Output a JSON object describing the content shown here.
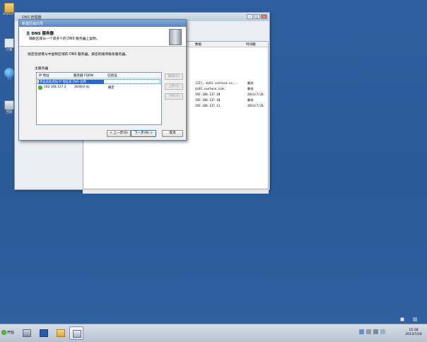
{
  "desktop": {
    "icons": [
      {
        "label": "Adminis",
        "icon": "folder-icon"
      },
      {
        "label": "计算",
        "icon": "computer-icon"
      },
      {
        "label": "Fl",
        "icon": "internet-explorer-icon"
      },
      {
        "label": "回收",
        "icon": "recycle-bin-icon"
      }
    ]
  },
  "dns_manager": {
    "title": "DNS 管理器",
    "columns": [
      "数据",
      "时间戳"
    ],
    "rows": [
      {
        "data": "[22], dc01.contoso.co...",
        "time": "静态"
      },
      {
        "data": "dc01.contoso.com.",
        "time": "静态"
      },
      {
        "data": "192.168.137.10",
        "time": "2013/7/26"
      },
      {
        "data": "192.168.137.10",
        "time": "静态"
      },
      {
        "data": "192.168.137.11",
        "time": "2013/7/26"
      }
    ]
  },
  "wizard": {
    "title": "新建区域向导",
    "header_title": "主 DNS 服务器",
    "header_subtitle": "辅助区域从一个或多个的 DNS 服务器上复制。",
    "description": "指定您想要从中复制区域的 DNS 服务器。按您的顺序联系服务器。",
    "group_label": "主服务器",
    "list_columns": [
      "IP 地址",
      "服务器 FQDN",
      "已验证"
    ],
    "rows": [
      {
        "ip": "单击此处添加 IP 地址或 DNS 名称",
        "fqdn": "",
        "verified": "",
        "editing": true
      },
      {
        "ip": "192.168.137.2",
        "fqdn": "2k08r2-dc",
        "verified": "确定"
      }
    ],
    "side_buttons": [
      "删除(D)",
      "上移(U)",
      "下移(O)"
    ],
    "buttons": {
      "back": "< 上一步(B)",
      "next": "下一步(N) >",
      "cancel": "取消"
    }
  },
  "taskbar": {
    "start_label": "开始",
    "apps": [
      "server-manager-icon",
      "powershell-icon",
      "explorer-icon",
      "dns-manager-icon"
    ],
    "clock_time": "15:38",
    "clock_date": "2013/7/26"
  }
}
